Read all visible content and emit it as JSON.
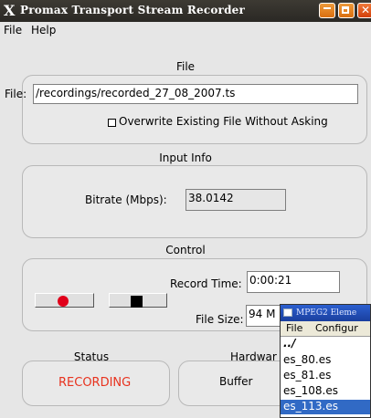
{
  "window": {
    "title": "Promax Transport Stream Recorder",
    "logo": "X"
  },
  "menu": {
    "file": "File",
    "help": "Help"
  },
  "file_section": {
    "heading": "File",
    "file_label": "File:",
    "file_value": "/recordings/recorded_27_08_2007.ts",
    "overwrite_label": "Overwrite Existing File Without Asking",
    "overwrite_checked": false
  },
  "input_section": {
    "heading": "Input Info",
    "bitrate_label": "Bitrate (Mbps):",
    "bitrate_value": "38.0142"
  },
  "control_section": {
    "heading": "Control",
    "record_time_label": "Record Time:",
    "record_time_value": "0:00:21",
    "file_size_label": "File Size:",
    "file_size_value": "94 M"
  },
  "status_section": {
    "heading": "Status",
    "status_text": "RECORDING",
    "status_color": "#e8321e"
  },
  "hardware_section": {
    "heading": "Hardwar",
    "buffer_label": "Buffer"
  },
  "popup": {
    "title": "MPEG2 Eleme",
    "menu_file": "File",
    "menu_configure": "Configur",
    "items": [
      {
        "label": "../",
        "selected": false
      },
      {
        "label": "es_80.es",
        "selected": false
      },
      {
        "label": "es_81.es",
        "selected": false
      },
      {
        "label": "es_108.es",
        "selected": false
      },
      {
        "label": "es_113.es",
        "selected": true
      }
    ]
  },
  "colors": {
    "record_button": "#e0001a",
    "stop_button": "#000000",
    "selection": "#316ac5"
  },
  "icons": {
    "record": "record-dot-icon",
    "stop": "stop-square-icon",
    "window_minimize": "minimize-icon",
    "window_maximize": "maximize-icon",
    "window_close": "close-icon"
  }
}
